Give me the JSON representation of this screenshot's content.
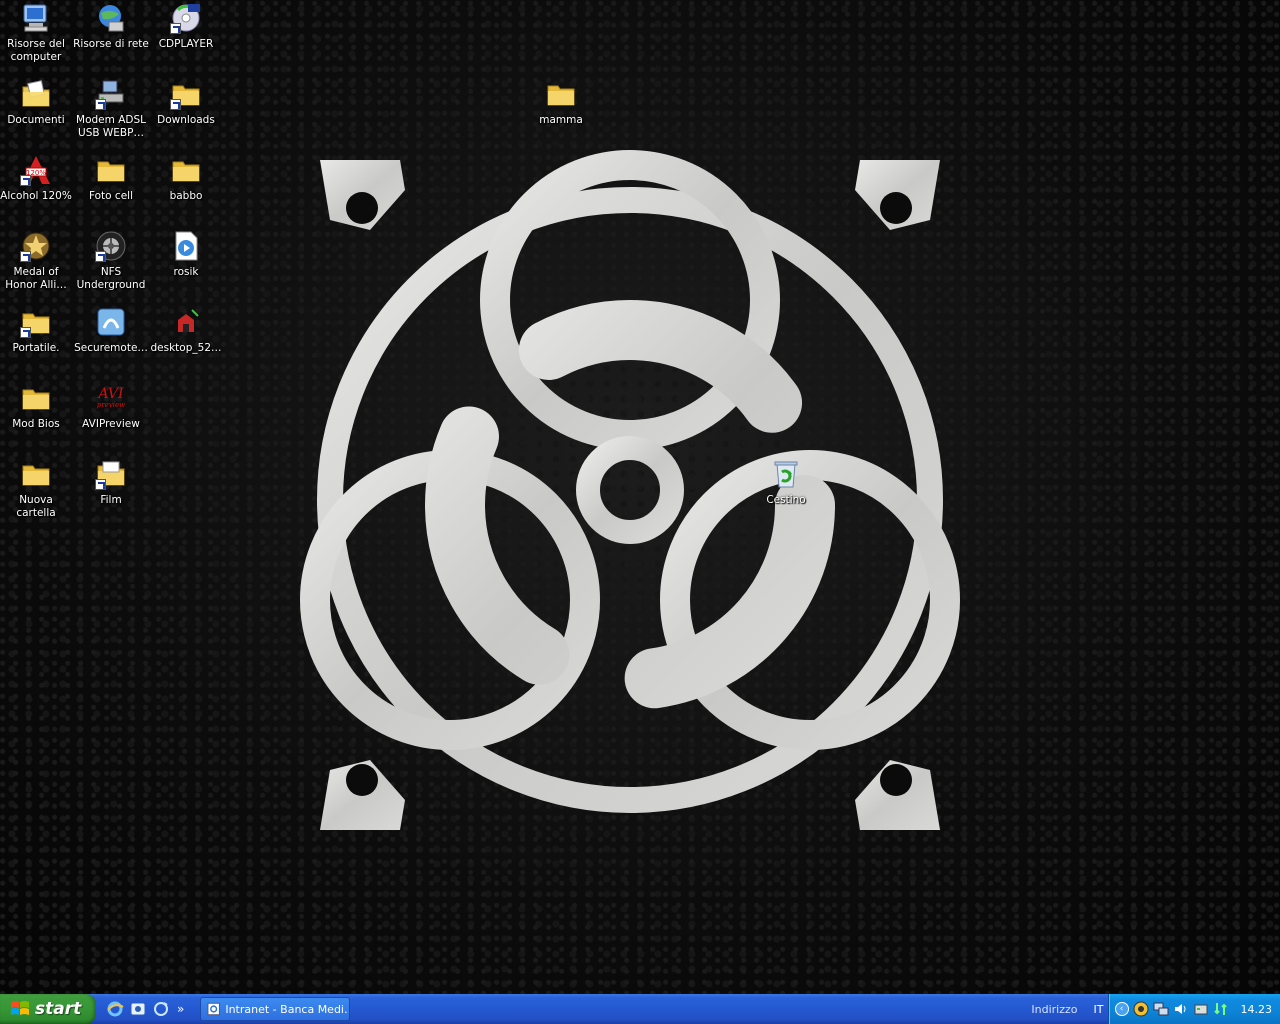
{
  "desktop": {
    "icons": [
      {
        "label": "Risorse del computer",
        "icon": "my-computer-icon"
      },
      {
        "label": "Risorse di rete",
        "icon": "network-places-icon"
      },
      {
        "label": "CDPLAYER",
        "icon": "cd-player-icon"
      },
      {
        "label": "Documenti",
        "icon": "my-documents-icon"
      },
      {
        "label": "Modem ADSL USB WEBP…",
        "icon": "modem-icon"
      },
      {
        "label": "Downloads",
        "icon": "folder-icon"
      },
      {
        "label": "Alcohol 120%",
        "icon": "alcohol-icon"
      },
      {
        "label": "Foto cell",
        "icon": "folder-icon"
      },
      {
        "label": "babbo",
        "icon": "folder-icon"
      },
      {
        "label": "Medal of Honor Alli…",
        "icon": "medal-icon"
      },
      {
        "label": "NFS Underground",
        "icon": "wheel-icon"
      },
      {
        "label": "rosik",
        "icon": "media-file-icon"
      },
      {
        "label": "Portatile.",
        "icon": "folder-icon"
      },
      {
        "label": "Securemote…",
        "icon": "securemote-icon"
      },
      {
        "label": "desktop_52…",
        "icon": "desktop-file-icon"
      },
      {
        "label": "Mod Bios",
        "icon": "folder-icon"
      },
      {
        "label": "AVIPreview",
        "icon": "avi-preview-icon"
      },
      {
        "label": "Nuova cartella",
        "icon": "folder-icon"
      },
      {
        "label": "Film",
        "icon": "folder-icon"
      },
      {
        "label": "mamma",
        "icon": "folder-icon"
      },
      {
        "label": "Cestino",
        "icon": "recycle-bin-icon"
      }
    ]
  },
  "taskbar": {
    "start_label": "start",
    "task_label": "Intranet - Banca Medi…",
    "address_label": "Indirizzo",
    "language": "IT",
    "clock": "14.23",
    "quicklaunch_more": "»",
    "tray_chevron": "‹"
  },
  "colors": {
    "taskbar": "#2458d1",
    "start": "#379636",
    "tray": "#0d84d6"
  }
}
